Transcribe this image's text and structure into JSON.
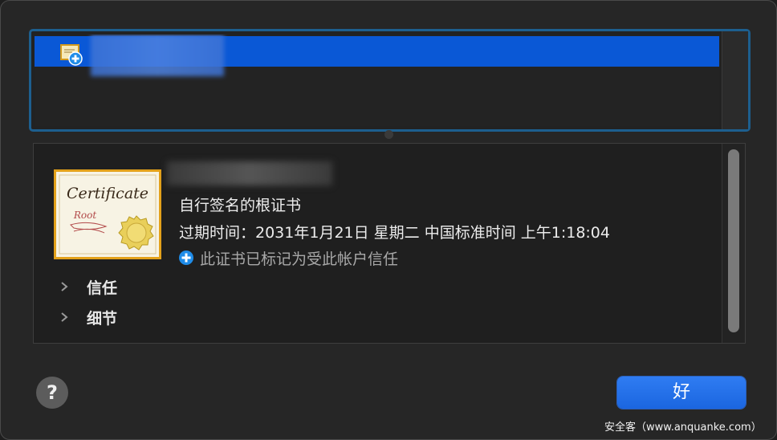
{
  "certificate_list": {
    "rows": [
      {
        "label": "",
        "selected": true,
        "icon": "certificate-plus-icon"
      }
    ]
  },
  "details": {
    "cert_image_text": {
      "title": "Certificate",
      "subtitle": "Root"
    },
    "type": "自行签名的根证书",
    "expiry": "过期时间：2031年1月21日 星期二 中国标准时间 上午1:18:04",
    "trust_status": "此证书已标记为受此帐户信任",
    "sections": [
      {
        "label": "信任",
        "icon": "chevron-right-icon"
      },
      {
        "label": "细节",
        "icon": "chevron-right-icon"
      }
    ]
  },
  "footer": {
    "help_label": "?",
    "ok_label": "好"
  },
  "watermark": "安全客（www.anquanke.com）",
  "colors": {
    "selection": "#0a58d6",
    "focus_ring": "#1d5f8f",
    "ok_button": "#2f7cf2",
    "cert_frame": "#e3a11a"
  }
}
